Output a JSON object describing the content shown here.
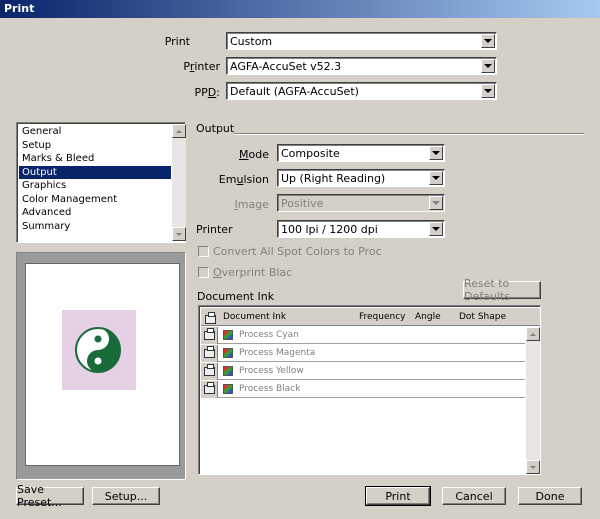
{
  "window": {
    "title": "Print"
  },
  "top": {
    "print_label": "Print",
    "print_value": "Custom",
    "printer_label_pre": "P",
    "printer_label_u": "r",
    "printer_label_post": "inter",
    "printer_value": "AGFA-AccuSet v52.3",
    "ppd_label_pre": "PP",
    "ppd_label_u": "D",
    "ppd_label_post": ":",
    "ppd_value": "Default (AGFA-AccuSet)"
  },
  "sidebar": {
    "items": [
      "General",
      "Setup",
      "Marks & Bleed",
      "Output",
      "Graphics",
      "Color Management",
      "Advanced",
      "Summary"
    ],
    "selected": "Output"
  },
  "output": {
    "section_title": "Output",
    "mode_label_u": "M",
    "mode_label_post": "ode",
    "mode_value": "Composite",
    "emulsion_label_pre": "Em",
    "emulsion_label_u": "u",
    "emulsion_label_post": "lsion",
    "emulsion_value": "Up (Right Reading)",
    "image_label_u": "I",
    "image_label_post": "mage",
    "image_value": "Positive",
    "printer_label": "Printer",
    "printer_value": "100 lpi  / 1200 dpi",
    "convert_label": "Convert All Spot Colors to Proc",
    "overprint_label_u": "O",
    "overprint_label_post": "verprint Blac"
  },
  "document_ink": {
    "title": "Document Ink",
    "reset_button": "Reset to Defaults",
    "columns": [
      "Document Ink",
      "Frequency",
      "Angle",
      "Dot Shape"
    ],
    "rows": [
      "Process Cyan",
      "Process Magenta",
      "Process Yellow",
      "Process Black"
    ]
  },
  "preview": {
    "background": "#e6d0e6",
    "symbol_color": "#1a6b3a"
  },
  "buttons": {
    "save_preset": "Save Preset...",
    "setup": "Setup...",
    "print": "Print",
    "cancel": "Cancel",
    "done": "Done"
  }
}
